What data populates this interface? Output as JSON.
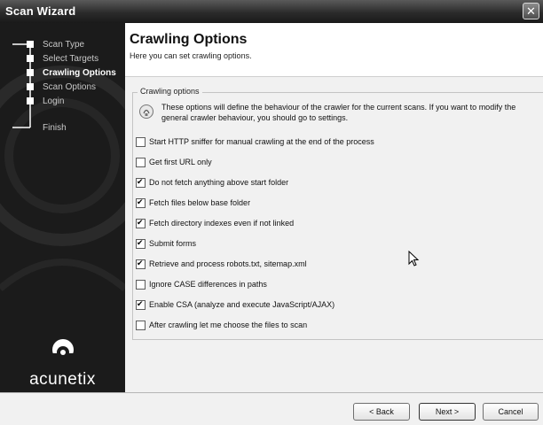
{
  "window": {
    "title": "Scan Wizard",
    "close_glyph": "✕"
  },
  "sidebar": {
    "steps": [
      {
        "label": "Scan Type",
        "active": false
      },
      {
        "label": "Select Targets",
        "active": false
      },
      {
        "label": "Crawling Options",
        "active": true
      },
      {
        "label": "Scan Options",
        "active": false
      },
      {
        "label": "Login",
        "active": false
      },
      {
        "label": "Finish",
        "active": false
      }
    ],
    "logo_text": "acunetix"
  },
  "header": {
    "title": "Crawling Options",
    "subtitle": "Here you can set crawling options."
  },
  "group": {
    "legend": "Crawling options",
    "info_text": "These options will define the behaviour of the crawler for the current scans. If you want to modify the general crawler behaviour, you should go to settings."
  },
  "options": [
    {
      "label": "Start HTTP sniffer for manual crawling at the end of the process",
      "checked": false
    },
    {
      "label": "Get first URL only",
      "checked": false
    },
    {
      "label": "Do not fetch anything above start folder",
      "checked": true
    },
    {
      "label": "Fetch files below base folder",
      "checked": true
    },
    {
      "label": "Fetch directory indexes even if not linked",
      "checked": true
    },
    {
      "label": "Submit forms",
      "checked": true
    },
    {
      "label": "Retrieve and process robots.txt, sitemap.xml",
      "checked": true
    },
    {
      "label": "Ignore CASE differences in paths",
      "checked": false
    },
    {
      "label": "Enable CSA (analyze and execute JavaScript/AJAX)",
      "checked": true
    },
    {
      "label": "After crawling let me choose the files to scan",
      "checked": false
    }
  ],
  "footer": {
    "back_label": "< Back",
    "next_label": "Next >",
    "cancel_label": "Cancel"
  },
  "colors": {
    "sidebar_bg": "#1b1b1b",
    "titlebar": "#2b2b2b",
    "panel_bg": "#f1f1f1"
  },
  "icons": [
    "close-icon",
    "step-marker-icon",
    "acunetix-logo-icon",
    "info-bulb-icon",
    "checkbox-icon",
    "mouse-cursor-icon"
  ]
}
